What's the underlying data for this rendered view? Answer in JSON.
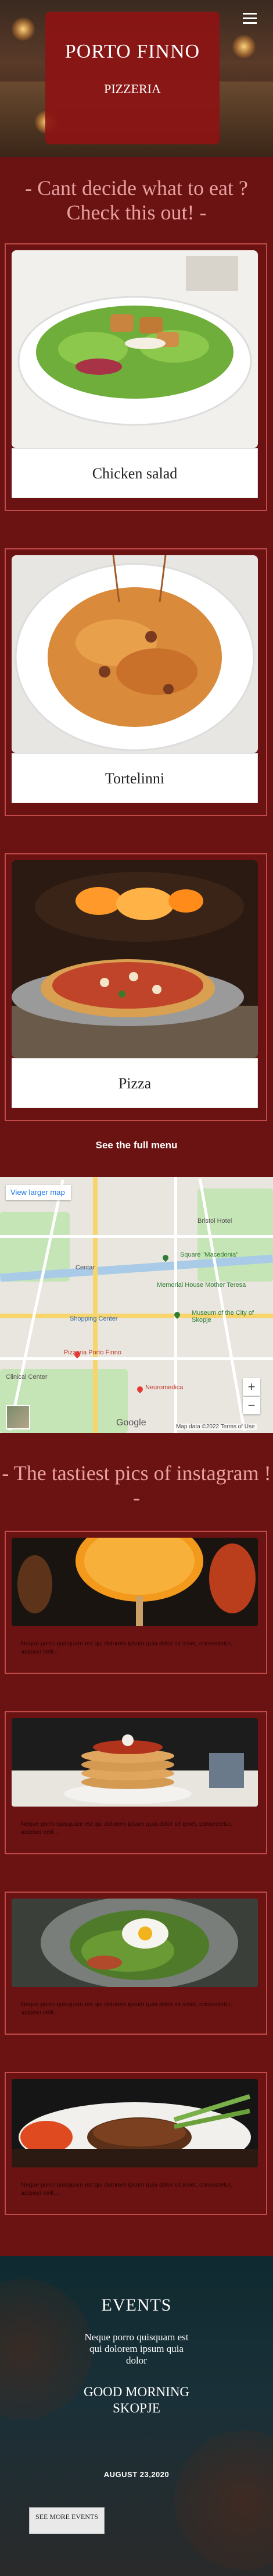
{
  "brand": {
    "name": "PORTO FINNO",
    "tagline": "PIZZERIA"
  },
  "menu_section": {
    "title": "- Cant decide what to eat ? Check this out! -"
  },
  "menu_items": [
    {
      "label": "Chicken salad"
    },
    {
      "label": "Tortelinni"
    },
    {
      "label": "Pizza"
    }
  ],
  "full_menu_link": "See the full menu",
  "map": {
    "view_larger": "View larger map",
    "zoom_in": "+",
    "zoom_out": "−",
    "provider": "Google",
    "attribution": "Map data ©2022  Terms of Use",
    "labels": [
      "Bristol Hotel",
      "Centar",
      "Square \"Macedonia\"",
      "Memorial House Mother Teresa",
      "Museum of the City of Skopje",
      "Shopping Center",
      "Pizzeria Porto Finno",
      "Clinical Center",
      "Neuromedica"
    ]
  },
  "instagram_section": {
    "title": "- The tastiest pics of instagram ! -"
  },
  "instagram_posts": [
    {
      "caption": "Neque porro quisquam est qui dolorem ipsum quia dolor sit amet, consectetur, adipisci velit..."
    },
    {
      "caption": "Neque porro quisquam est qui dolorem ipsum quia dolor sit amet, consectetur, adipisci velit..."
    },
    {
      "caption": "Neque porro quisquam est qui dolorem ipsum quia dolor sit amet, consectetur, adipisci velit..."
    },
    {
      "caption": "Neque porro quisquam est qui dolorem ipsum quia dolor sit amet, consectetur, adipisci velit..."
    }
  ],
  "events": {
    "title": "EVENTS",
    "description": "Neque porro quisquam est qui dolorem ipsum quia dolor",
    "event_name": "GOOD MORNING SKOPJE",
    "date": "AUGUST 23,2020",
    "button_label": "SEE MORE EVENTS"
  },
  "colors": {
    "background": "#6b1313",
    "brand_box": "#8c1414",
    "accent_text": "#e8a0a0",
    "card_border": "#c24a4a"
  }
}
